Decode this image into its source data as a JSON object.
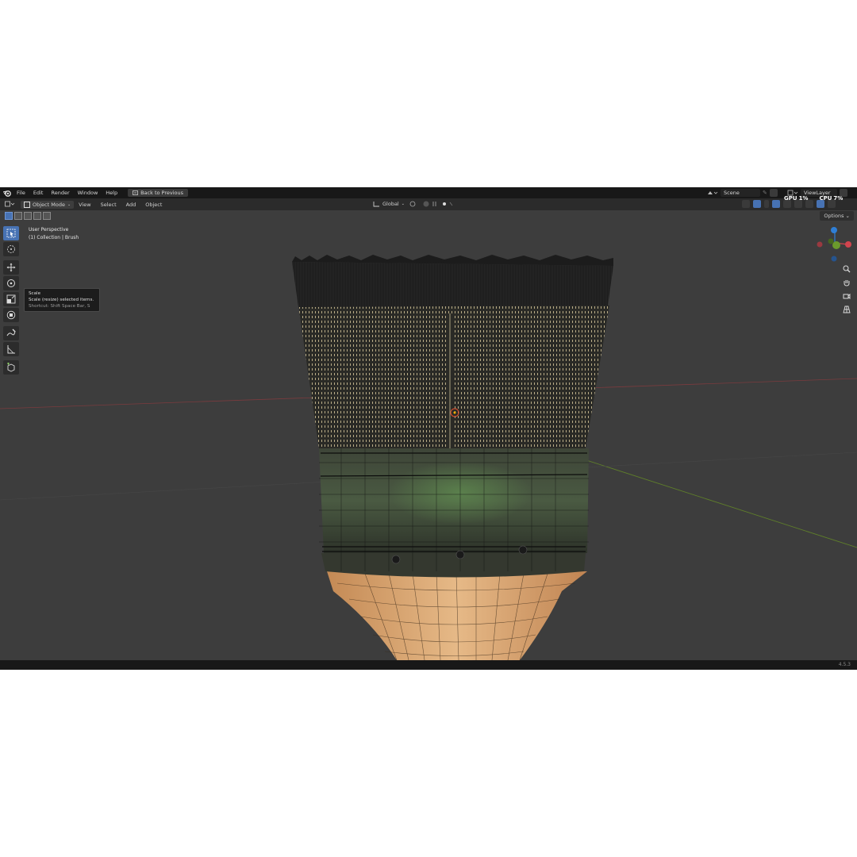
{
  "topbar": {
    "menus": [
      "File",
      "Edit",
      "Render",
      "Window",
      "Help"
    ],
    "back_button": "Back to Previous",
    "scene": "Scene",
    "view_layer": "ViewLayer"
  },
  "header": {
    "mode": "Object Mode",
    "menus": [
      "View",
      "Select",
      "Add",
      "Object"
    ],
    "transform_orientation": "Global",
    "options": "Options"
  },
  "viewport": {
    "perspective": "User Perspective",
    "collection": "(1) Collection | Brush"
  },
  "tooltip": {
    "title": "Scale",
    "description": "Scale (resize) selected items.",
    "shortcut": "Shortcut: Shift Space Bar, S"
  },
  "monitor": {
    "gpu_label": "GPU",
    "gpu_value": "1%",
    "cpu_label": "CPU",
    "cpu_value": "7%"
  },
  "statusbar": {
    "version": "4.5.3"
  },
  "icons": {
    "toolbar": [
      "select-box-icon",
      "cursor-icon",
      "move-icon",
      "rotate-icon",
      "scale-icon",
      "transform-icon",
      "annotate-icon",
      "measure-icon",
      "add-cube-icon"
    ],
    "gizmo_axes": [
      "z-axis",
      "y-axis",
      "x-axis",
      "neg-x-axis",
      "neg-z-axis"
    ]
  },
  "colors": {
    "accent": "#4772b3",
    "viewport_bg": "#3d3d3d",
    "x_axis": "#d2444e",
    "y_axis": "#6b9a2c",
    "z_axis": "#2f7fd6"
  }
}
